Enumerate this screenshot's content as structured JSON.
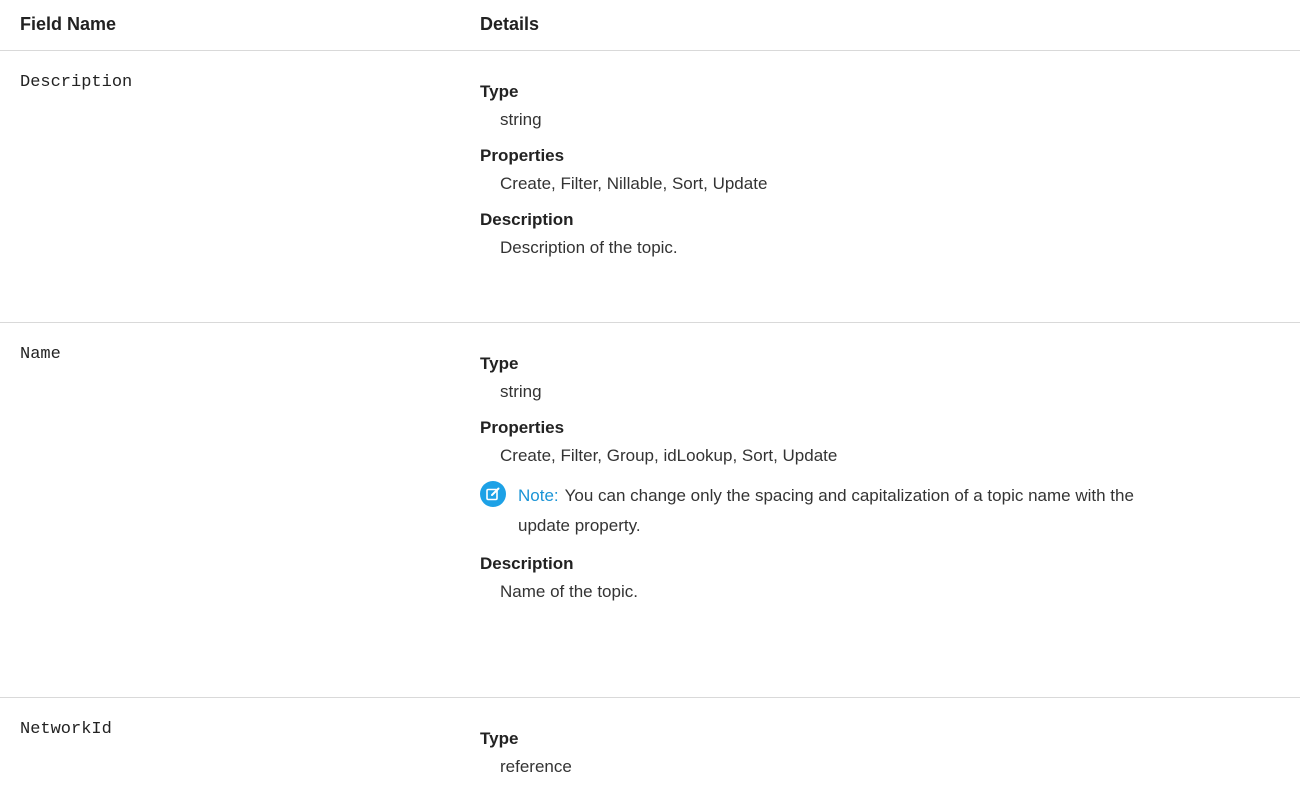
{
  "header": {
    "field_name": "Field Name",
    "details": "Details"
  },
  "rows": [
    {
      "field": "Description",
      "type_label": "Type",
      "type_value": "string",
      "properties_label": "Properties",
      "properties_value": "Create, Filter, Nillable, Sort, Update",
      "description_label": "Description",
      "description_value": "Description of the topic."
    },
    {
      "field": "Name",
      "type_label": "Type",
      "type_value": "string",
      "properties_label": "Properties",
      "properties_value": "Create, Filter, Group, idLookup, Sort, Update",
      "note_label": "Note:",
      "note_text": "You can change only the spacing and capitalization of a topic name with the update property.",
      "description_label": "Description",
      "description_value": "Name of the topic."
    },
    {
      "field": "NetworkId",
      "type_label": "Type",
      "type_value": "reference"
    }
  ],
  "icons": {
    "note": "pencil-edit-icon"
  },
  "colors": {
    "note_accent": "#1da1e6",
    "divider": "#d9d9d9"
  }
}
